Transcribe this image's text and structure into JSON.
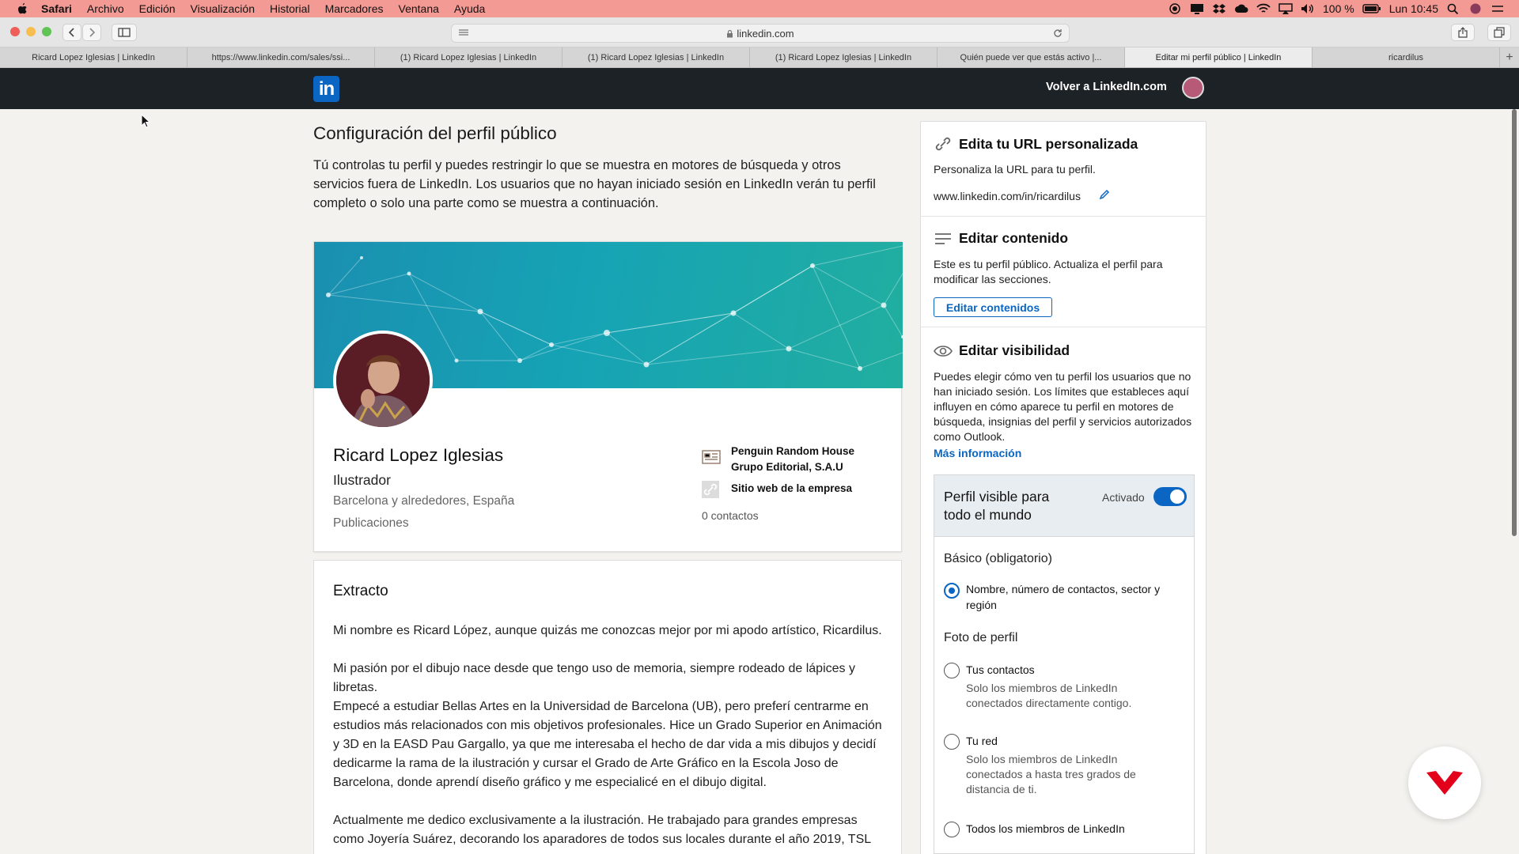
{
  "menubar": {
    "app": "Safari",
    "items": [
      "Archivo",
      "Edición",
      "Visualización",
      "Historial",
      "Marcadores",
      "Ventana",
      "Ayuda"
    ],
    "battery": "100 %",
    "clock": "Lun 10:45"
  },
  "toolbar": {
    "url": "linkedin.com"
  },
  "tabs": [
    "Ricard Lopez Iglesias | LinkedIn",
    "https://www.linkedin.com/sales/ssi...",
    "(1) Ricard Lopez Iglesias | LinkedIn",
    "(1) Ricard Lopez Iglesias | LinkedIn",
    "(1) Ricard Lopez Iglesias | LinkedIn",
    "Quién puede ver que estás activo |...",
    "Editar mi perfil público | LinkedIn",
    "ricardilus"
  ],
  "nav": {
    "logo": "in",
    "back": "Volver a LinkedIn.com"
  },
  "page": {
    "title": "Configuración del perfil público",
    "intro": "Tú controlas tu perfil y puedes restringir lo que se muestra en motores de búsqueda y otros servicios fuera de LinkedIn. Los usuarios que no hayan iniciado sesión en LinkedIn verán tu perfil completo o solo una parte como se muestra a continuación."
  },
  "profile": {
    "name": "Ricard Lopez Iglesias",
    "headline": "Ilustrador",
    "location": "Barcelona y alrededores, España",
    "industry": "Publicaciones",
    "company": "Penguin Random House Grupo Editorial, S.A.U",
    "website": "Sitio web de la empresa",
    "contacts": "0 contactos"
  },
  "extract": {
    "heading": "Extracto",
    "p1": "Mi nombre es Ricard López, aunque quizás me conozcas mejor por mi apodo artístico, Ricardilus.",
    "p2": "Mi pasión por el dibujo nace desde que tengo uso de memoria, siempre rodeado de lápices y libretas.",
    "p3": "Empecé a estudiar Bellas Artes en la Universidad de Barcelona (UB), pero preferí centrarme en estudios más relacionados con mis objetivos profesionales. Hice un Grado Superior en Animación y 3D en la EASD Pau Gargallo, ya que me interesaba el hecho de dar vida a mis dibujos y decidí dedicarme la rama de la ilustración y cursar el Grado de Arte Gráfico en la Escola Joso de Barcelona, donde aprendí diseño gráfico y me especialicé en el dibujo digital.",
    "p4": "Actualmente me dedico exclusivamente a la ilustración. He trabajado para grandes empresas como Joyería Suárez, decorando los aparadores de todos sus locales durante el año 2019, TSL"
  },
  "sidebar": {
    "url_heading": "Edita tu URL personalizada",
    "url_desc": "Personaliza la URL para tu perfil.",
    "url_value": "www.linkedin.com/in/ricardilus",
    "content_heading": "Editar contenido",
    "content_desc": "Este es tu perfil público. Actualiza el perfil para modificar las secciones.",
    "content_button": "Editar contenidos",
    "vis_heading": "Editar visibilidad",
    "vis_desc": "Puedes elegir cómo ven tu perfil los usuarios que no han iniciado sesión. Los límites que estableces aquí influyen en cómo aparece tu perfil en motores de búsqueda, insignias del perfil y servicios autorizados como Outlook.",
    "vis_more": "Más información",
    "visible_title": "Perfil visible para todo el mundo",
    "visible_state": "Activado",
    "visible_on": true,
    "basic_label": "Básico (obligatorio)",
    "basic_option": "Nombre, número de contactos, sector y región",
    "photo_label": "Foto de perfil",
    "opt1": "Tus contactos",
    "opt1_desc": "Solo los miembros de LinkedIn conectados directamente contigo.",
    "opt2": "Tu red",
    "opt2_desc": "Solo los miembros de LinkedIn conectados a hasta tres grados de distancia de ti.",
    "opt3": "Todos los miembros de LinkedIn"
  },
  "colors": {
    "menubar": "#f49a94",
    "linkedin_blue": "#0a66c2",
    "nav_dark": "#1d2226",
    "badge_red": "#e2001a"
  }
}
